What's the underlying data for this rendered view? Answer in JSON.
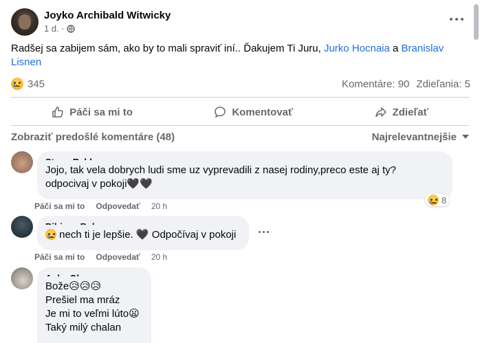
{
  "post": {
    "author": "Joyko Archibald Witwicky",
    "time": "1 d. ·",
    "text_main": "Radšej sa zabijem sám, ako by to mali spraviť iní.. Ďakujem Ti Juru,",
    "mention_1": "Jurko Hocnaia",
    "connector": "a",
    "mention_2": "Branislav Lisnen",
    "reaction_count": "345",
    "comments_count": "Komentáre: 90",
    "shares_count": "Zdieľania: 5"
  },
  "actions": {
    "like": "Páči sa mi to",
    "comment": "Komentovať",
    "share": "Zdieľať"
  },
  "comments_bar": {
    "show_previous": "Zobraziť predošlé komentáre (48)",
    "sort": "Najrelevantnejšie"
  },
  "comments": [
    {
      "name": "Stano Rebly",
      "text_1": "Jojo, tak vela dobrych ludi sme uz vypreva​dili z nasej rodiny,preco este aj ty?",
      "text_2": "odpocivaj v pokoji",
      "hearts": "🖤🖤",
      "like": "Páči sa mi to",
      "reply": "Odpovedať",
      "time": "20 h",
      "reaction_count": "8"
    },
    {
      "name": "Bibiana Bolanec",
      "text": "nech ti je lepšie.",
      "text_2": "Odpočívaj v pokoji",
      "like": "Páči sa mi to",
      "reply": "Odpovedať",
      "time": "20 h"
    },
    {
      "name": "Anka Olano",
      "line_1": "Bože",
      "line_2": "Prešiel ma mráz",
      "line_3": "Je mi to veľmi lúto",
      "line_4": "Taký milý chalan"
    }
  ],
  "colors": {
    "link": "#216fdb",
    "secondary_text": "#65676b",
    "bubble": "#f0f2f5"
  }
}
